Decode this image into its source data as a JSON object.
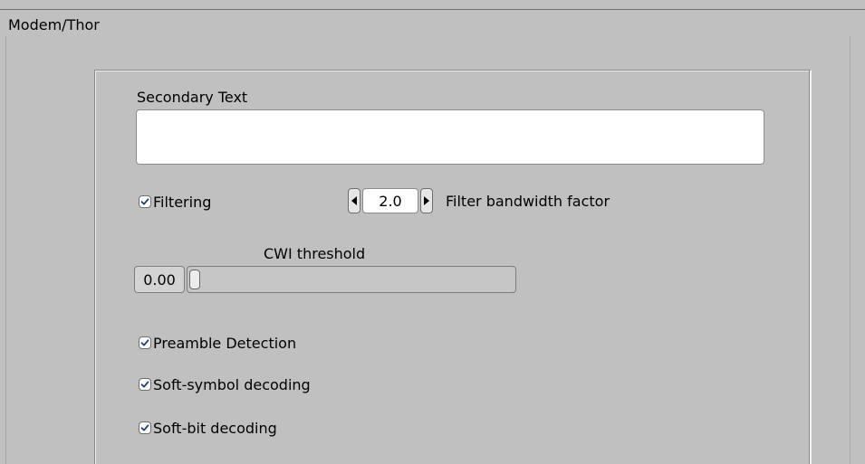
{
  "section": {
    "title": "Modem/Thor"
  },
  "secondary_text": {
    "label": "Secondary Text",
    "value": ""
  },
  "filtering": {
    "label": "Filtering",
    "checked": true
  },
  "filter_bandwidth": {
    "value": "2.0",
    "label": "Filter bandwidth factor"
  },
  "cwi_threshold": {
    "label": "CWI threshold",
    "value": "0.00",
    "level": 0
  },
  "preamble_detection": {
    "label": "Preamble Detection",
    "checked": true
  },
  "soft_symbol_decoding": {
    "label": "Soft-symbol decoding",
    "checked": true
  },
  "soft_bit_decoding": {
    "label": "Soft-bit decoding",
    "checked": true
  },
  "icons": {
    "checkbox_mark": "check-icon",
    "decrement": "triangle-left-icon",
    "increment": "triangle-right-icon"
  },
  "colors": {
    "background": "#c0c0c0",
    "field": "#ffffff",
    "check_mark": "#1f3f7a"
  }
}
